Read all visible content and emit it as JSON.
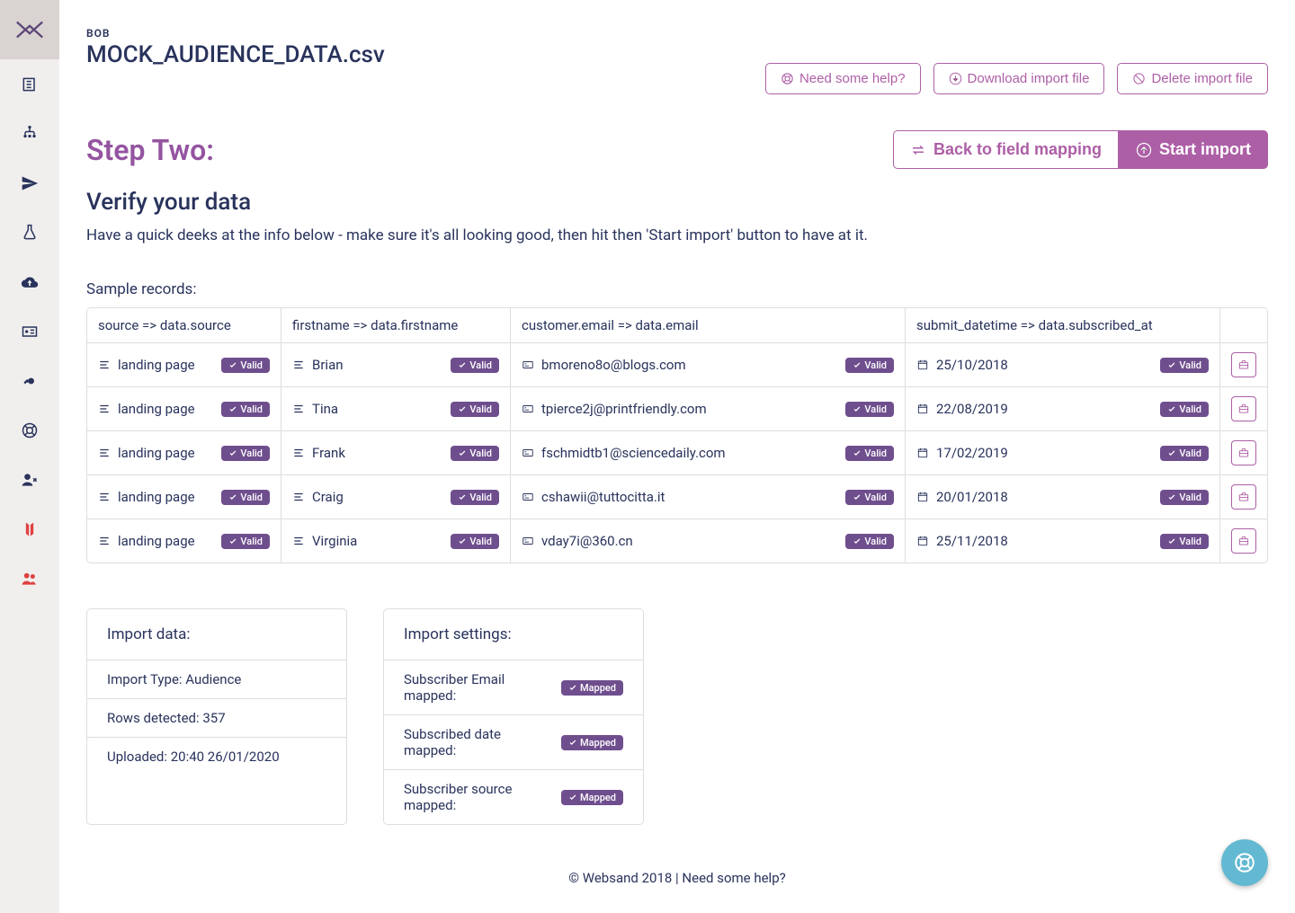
{
  "breadcrumb": "BOB",
  "filename": "MOCK_AUDIENCE_DATA.csv",
  "header_actions": {
    "help": "Need some help?",
    "download": "Download import file",
    "delete": "Delete import file"
  },
  "step": {
    "title": "Step Two:",
    "back_label": "Back to field mapping",
    "start_label": "Start import",
    "verify_heading": "Verify your data",
    "verify_desc": "Have a quick deeks at the info below - make sure it's all looking good, then hit then 'Start import' button to have at it."
  },
  "sample_label": "Sample records:",
  "columns": [
    "source => data.source",
    "firstname => data.firstname",
    "customer.email => data.email",
    "submit_datetime => data.subscribed_at"
  ],
  "valid_label": "Valid",
  "rows": [
    {
      "source": "landing page",
      "firstname": "Brian",
      "email": "bmoreno8o@blogs.com",
      "date": "25/10/2018"
    },
    {
      "source": "landing page",
      "firstname": "Tina",
      "email": "tpierce2j@printfriendly.com",
      "date": "22/08/2019"
    },
    {
      "source": "landing page",
      "firstname": "Frank",
      "email": "fschmidtb1@sciencedaily.com",
      "date": "17/02/2019"
    },
    {
      "source": "landing page",
      "firstname": "Craig",
      "email": "cshawii@tuttocitta.it",
      "date": "20/01/2018"
    },
    {
      "source": "landing page",
      "firstname": "Virginia",
      "email": "vday7i@360.cn",
      "date": "25/11/2018"
    }
  ],
  "import_data": {
    "title": "Import data:",
    "type_label": "Import Type: Audience",
    "rows_label": "Rows detected: 357",
    "uploaded_label": "Uploaded: 20:40 26/01/2020"
  },
  "import_settings": {
    "title": "Import settings:",
    "mapped_label": "Mapped",
    "email_label": "Subscriber Email mapped:",
    "date_label": "Subscribed date mapped:",
    "source_label": "Subscriber source mapped:"
  },
  "footer": "© Websand 2018 | Need some help?"
}
